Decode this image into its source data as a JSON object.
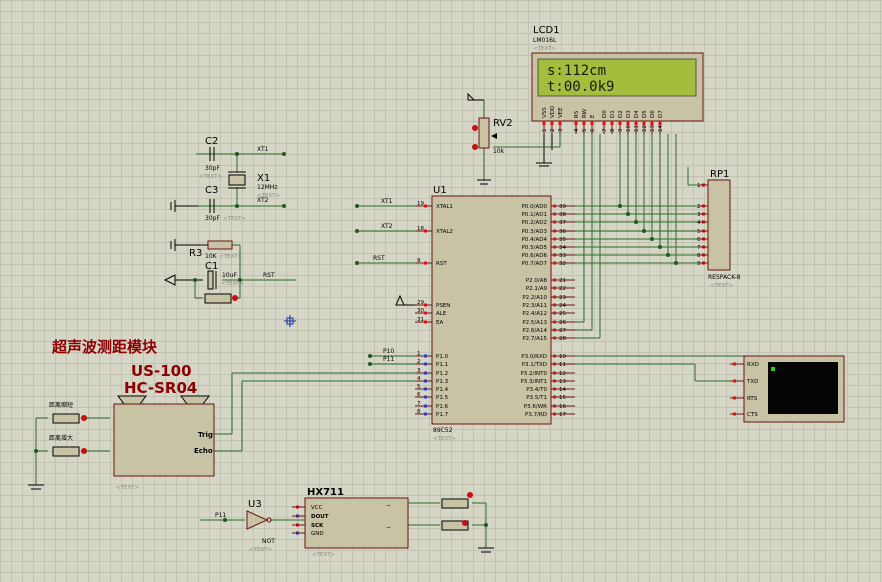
{
  "lcd": {
    "ref": "LCD1",
    "part": "LM016L",
    "text_tag": "<TEXT>",
    "line1": "s:112cm",
    "line2": "t:00.0k9",
    "pins": [
      "VSS",
      "VDD",
      "VEE",
      "RS",
      "RW",
      "E",
      "D0",
      "D1",
      "D2",
      "D3",
      "D4",
      "D5",
      "D6",
      "D7"
    ],
    "pin_nums": [
      "1",
      "2",
      "3",
      "4",
      "5",
      "6",
      "7",
      "8",
      "9",
      "10",
      "11",
      "12",
      "13",
      "14"
    ]
  },
  "rv2": {
    "ref": "RV2",
    "value": "10k"
  },
  "rp1": {
    "ref": "RP1",
    "part": "RESPACK-8",
    "text_tag": "<TEXT>",
    "pins": [
      "1",
      "2",
      "3",
      "4",
      "5",
      "6",
      "7",
      "8",
      "9"
    ]
  },
  "crystal": {
    "c2": {
      "ref": "C2",
      "value": "30pF",
      "text_tag": "<TEXT>"
    },
    "c3": {
      "ref": "C3",
      "value": "30pF",
      "text_tag": "<TEXT>"
    },
    "x1": {
      "ref": "X1",
      "value": "12MHz",
      "text_tag": "<TEXT>"
    },
    "net_xt1": "XT1",
    "net_xt2": "XT2"
  },
  "reset": {
    "r3": {
      "ref": "R3",
      "value": "10K",
      "text_tag": "<TEXT>"
    },
    "c1": {
      "ref": "C1",
      "value": "10uF",
      "text_tag": "<TEXT>"
    },
    "net_rst": "RST"
  },
  "mcu": {
    "ref": "U1",
    "part": "89C52",
    "text_tag": "<TEXT>",
    "left_pins": [
      {
        "num": "19",
        "name": "XTAL1"
      },
      {
        "num": "18",
        "name": "XTAL2"
      },
      {
        "num": "9",
        "name": "RST"
      },
      {
        "num": "29",
        "name": "PSEN"
      },
      {
        "num": "30",
        "name": "ALE"
      },
      {
        "num": "31",
        "name": "EA"
      },
      {
        "num": "1",
        "name": "P1.0"
      },
      {
        "num": "2",
        "name": "P1.1"
      },
      {
        "num": "3",
        "name": "P1.2"
      },
      {
        "num": "4",
        "name": "P1.3"
      },
      {
        "num": "5",
        "name": "P1.4"
      },
      {
        "num": "6",
        "name": "P1.5"
      },
      {
        "num": "7",
        "name": "P1.6"
      },
      {
        "num": "8",
        "name": "P1.7"
      }
    ],
    "right_pins": [
      {
        "num": "39",
        "name": "P0.0/AD0"
      },
      {
        "num": "38",
        "name": "P0.1/AD1"
      },
      {
        "num": "37",
        "name": "P0.2/AD2"
      },
      {
        "num": "36",
        "name": "P0.3/AD3"
      },
      {
        "num": "35",
        "name": "P0.4/AD4"
      },
      {
        "num": "34",
        "name": "P0.5/AD5"
      },
      {
        "num": "33",
        "name": "P0.6/AD6"
      },
      {
        "num": "32",
        "name": "P0.7/AD7"
      },
      {
        "num": "21",
        "name": "P2.0/A8"
      },
      {
        "num": "22",
        "name": "P2.1/A9"
      },
      {
        "num": "23",
        "name": "P2.2/A10"
      },
      {
        "num": "24",
        "name": "P2.3/A11"
      },
      {
        "num": "25",
        "name": "P2.4/A12"
      },
      {
        "num": "26",
        "name": "P2.5/A13"
      },
      {
        "num": "27",
        "name": "P2.6/A14"
      },
      {
        "num": "28",
        "name": "P2.7/A15"
      },
      {
        "num": "10",
        "name": "P3.0/RXD"
      },
      {
        "num": "11",
        "name": "P3.1/TXD"
      },
      {
        "num": "12",
        "name": "P3.2/INT0"
      },
      {
        "num": "13",
        "name": "P3.3/INT1"
      },
      {
        "num": "14",
        "name": "P3.4/T0"
      },
      {
        "num": "15",
        "name": "P3.5/T1"
      },
      {
        "num": "16",
        "name": "P3.6/WR"
      },
      {
        "num": "17",
        "name": "P3.7/RD"
      }
    ],
    "net_xt1": "XT1",
    "net_xt2": "XT2",
    "net_rst": "RST",
    "net_p10": "P10",
    "net_p11": "P11"
  },
  "ultrasonic": {
    "title_cn": "超声波测距模块",
    "model1": "US-100",
    "model2": "HC-SR04",
    "trig": "Trig",
    "echo": "Echo",
    "text_tag": "<TEXT>",
    "btn_down": "距离缩短",
    "btn_up": "距离增大"
  },
  "terminal": {
    "pins": [
      "RXD",
      "TXD",
      "RTS",
      "CTS"
    ]
  },
  "hx711": {
    "ref": "HX711",
    "pins": [
      "VCC",
      "DOUT",
      "SCK",
      "GND"
    ],
    "minus": "−",
    "u3": {
      "ref": "U3",
      "part": "NOT",
      "text_tag": "<TEXT>"
    },
    "net_p11": "P11",
    "text_tag": "<TEXT>"
  }
}
